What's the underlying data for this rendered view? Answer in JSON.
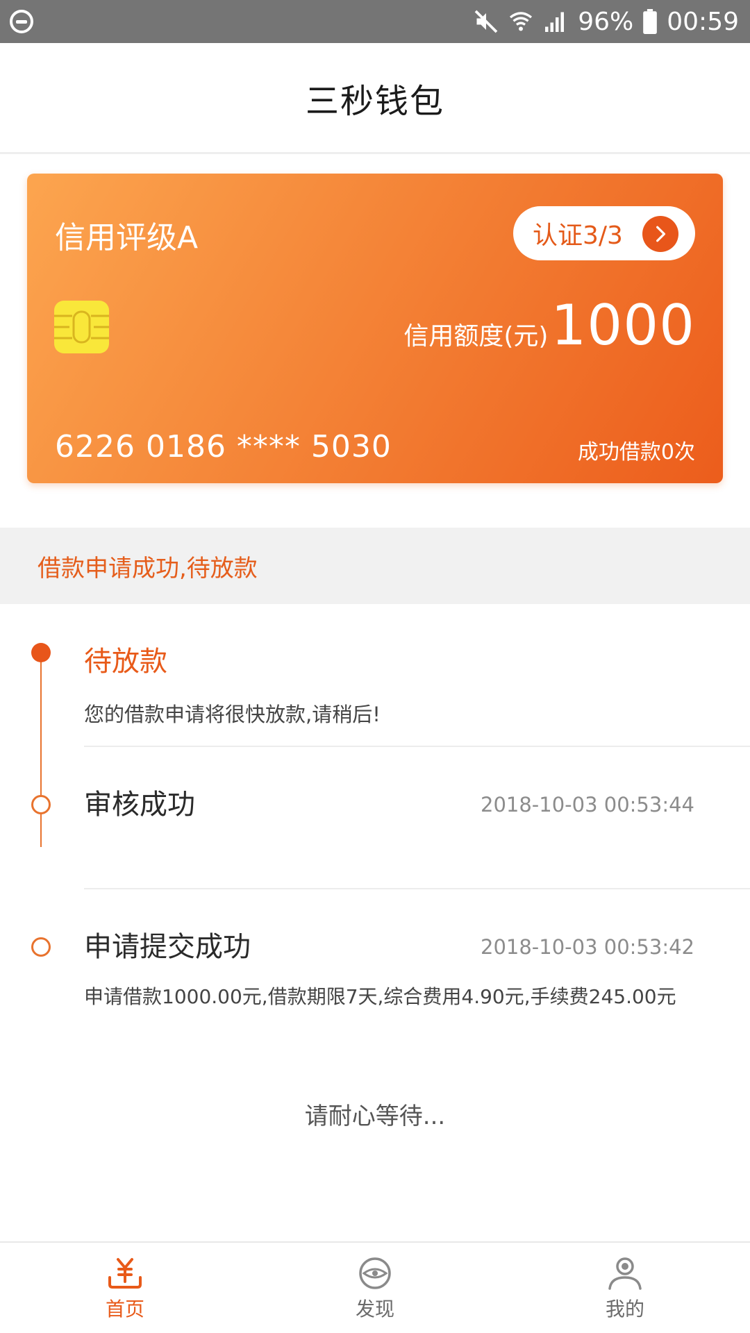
{
  "status_bar": {
    "battery": "96%",
    "time": "00:59",
    "icons": [
      "do-not-disturb-icon",
      "mute-icon",
      "wifi-icon",
      "signal-icon",
      "battery-icon"
    ]
  },
  "app_bar": {
    "title": "三秒钱包"
  },
  "credit_card": {
    "rating": "信用评级A",
    "certification": "认证3/3",
    "limit_label": "信用额度(元)",
    "limit_value": "1000",
    "card_number": "6226 0186 **** 5030",
    "loan_count": "成功借款0次",
    "gradient_start": "#fca54f",
    "gradient_end": "#ec5d1c"
  },
  "notice": {
    "text": "借款申请成功,待放款"
  },
  "timeline": [
    {
      "title": "待放款",
      "description": "您的借款申请将很快放款,请稍后!",
      "time": "",
      "state": "active"
    },
    {
      "title": "审核成功",
      "description": "",
      "time": "2018-10-03 00:53:44",
      "state": "done"
    },
    {
      "title": "申请提交成功",
      "description": "申请借款1000.00元,借款期限7天,综合费用4.90元,手续费245.00元",
      "time": "2018-10-03 00:53:42",
      "state": "done"
    }
  ],
  "wait_message": "请耐心等待...",
  "tab_bar": {
    "tabs": [
      {
        "label": "首页",
        "icon": "home-yuan-icon",
        "active": true
      },
      {
        "label": "发现",
        "icon": "eye-icon",
        "active": false
      },
      {
        "label": "我的",
        "icon": "person-icon",
        "active": false
      }
    ]
  },
  "colors": {
    "accent": "#e85a19",
    "status_bar": "#757575"
  }
}
